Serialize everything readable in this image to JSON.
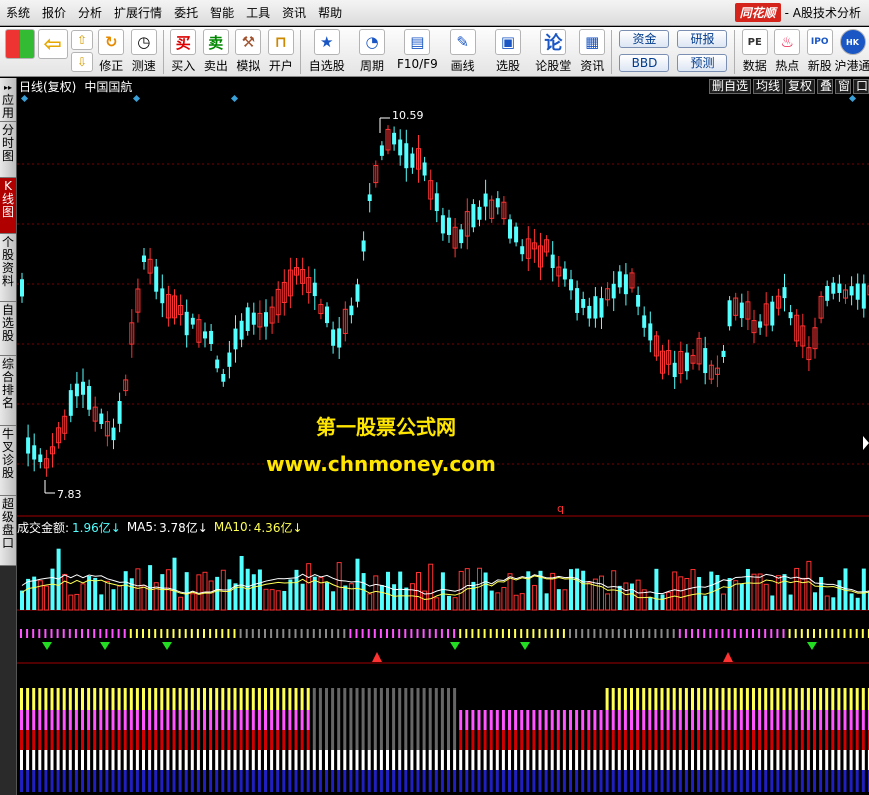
{
  "menu": [
    "系统",
    "报价",
    "分析",
    "扩展行情",
    "委托",
    "智能",
    "工具",
    "资讯",
    "帮助"
  ],
  "brand": {
    "logo": "同花顺",
    "sub": "- A股技术分析"
  },
  "toolbar": {
    "buy": "买入",
    "sell": "卖出",
    "mock": "模拟",
    "open": "开户",
    "watch": "自选股",
    "period": "周期",
    "f10": "F10/F9",
    "draw": "画线",
    "pick": "选股",
    "forum": "论股堂",
    "news": "资讯",
    "fix": "修正",
    "measure": "测速",
    "fund": "资金",
    "research": "研报",
    "bbd": "BBD",
    "forecast": "预测",
    "data": "数据",
    "hot": "热点",
    "newstock": "新股",
    "hk": "沪港通",
    "buy_glyph": "买",
    "sell_glyph": "卖",
    "forum_glyph": "论"
  },
  "leftnav": [
    {
      "label": "应用",
      "glyph": "▸▸"
    },
    {
      "label": "分时图"
    },
    {
      "label": "K线图",
      "active": true
    },
    {
      "label": "个股资料"
    },
    {
      "label": "自选股"
    },
    {
      "label": "综合排名"
    },
    {
      "label": "牛叉诊股"
    },
    {
      "label": "超级盘口"
    }
  ],
  "chart_header": {
    "title": "日线(复权)",
    "stock": "中国国航",
    "tabs": [
      "删自选",
      "均线",
      "复权",
      "叠",
      "窗",
      "口"
    ]
  },
  "price": {
    "high_label": "10.59",
    "low_label": "7.83",
    "q_marker": "q"
  },
  "volume": {
    "label": "成交金额:",
    "value": "1.96亿↓",
    "ma5_label": "MA5:",
    "ma5": "3.78亿↓",
    "ma10_label": "MA10:",
    "ma10": "4.36亿↓"
  },
  "watermark": {
    "line1": "第一股票公式网",
    "line2": "www.chnmoney.com"
  },
  "colors": {
    "up": "#ff3232",
    "down": "#54ffff",
    "bg": "#000000",
    "grid": "#7a0000",
    "yellow": "#ffff54",
    "magenta": "#ff54ff",
    "white": "#ffffff"
  }
}
